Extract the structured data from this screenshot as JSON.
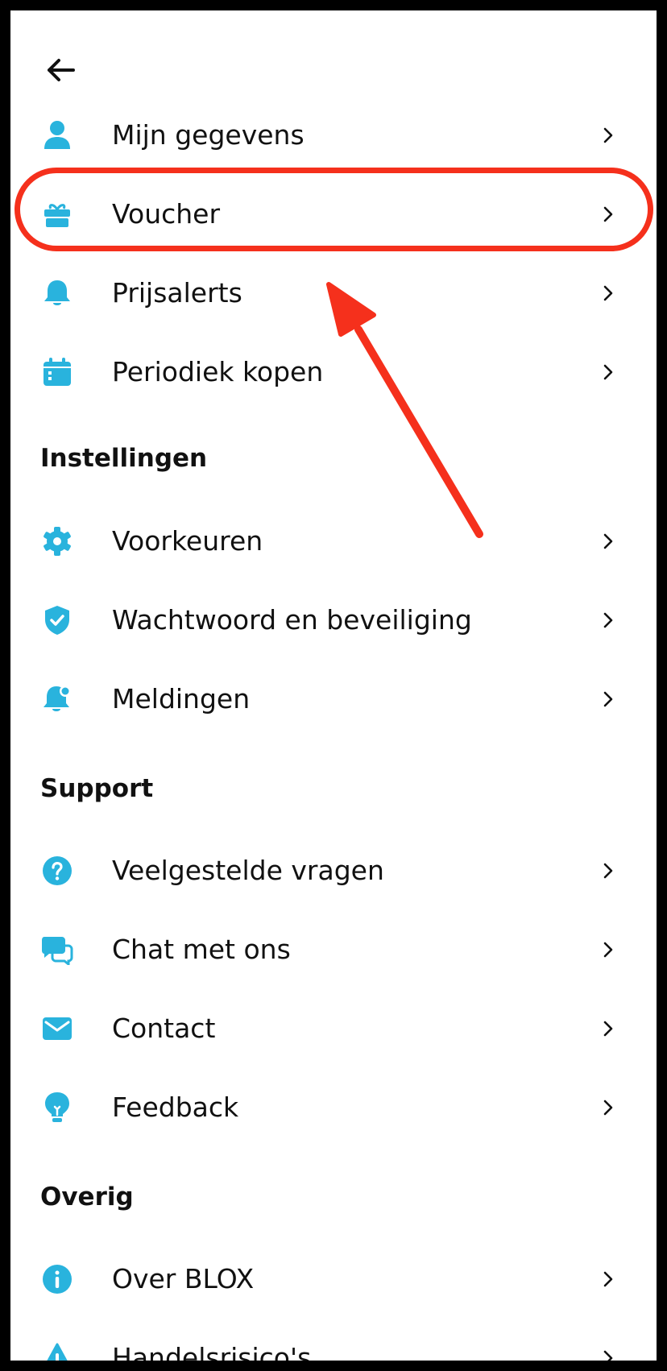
{
  "accent_color": "#29b3dd",
  "annotation_color": "#f5301c",
  "back_icon": "arrow-left-icon",
  "account": [
    {
      "label": "Mijn gegevens",
      "icon": "user-icon"
    },
    {
      "label": "Voucher",
      "icon": "gift-icon"
    },
    {
      "label": "Prijsalerts",
      "icon": "bell-icon"
    },
    {
      "label": "Periodiek kopen",
      "icon": "calendar-icon"
    }
  ],
  "settings": {
    "title": "Instellingen",
    "items": [
      {
        "label": "Voorkeuren",
        "icon": "gear-icon"
      },
      {
        "label": "Wachtwoord en beveiliging",
        "icon": "shield-check-icon"
      },
      {
        "label": "Meldingen",
        "icon": "notification-bell-icon"
      }
    ]
  },
  "support": {
    "title": "Support",
    "items": [
      {
        "label": "Veelgestelde vragen",
        "icon": "question-icon"
      },
      {
        "label": "Chat met ons",
        "icon": "chat-icon"
      },
      {
        "label": "Contact",
        "icon": "mail-icon"
      },
      {
        "label": "Feedback",
        "icon": "lightbulb-icon"
      }
    ]
  },
  "other": {
    "title": "Overig",
    "items": [
      {
        "label": "Over BLOX",
        "icon": "info-icon"
      },
      {
        "label": "Handelsrisico's",
        "icon": "warning-icon"
      }
    ]
  }
}
